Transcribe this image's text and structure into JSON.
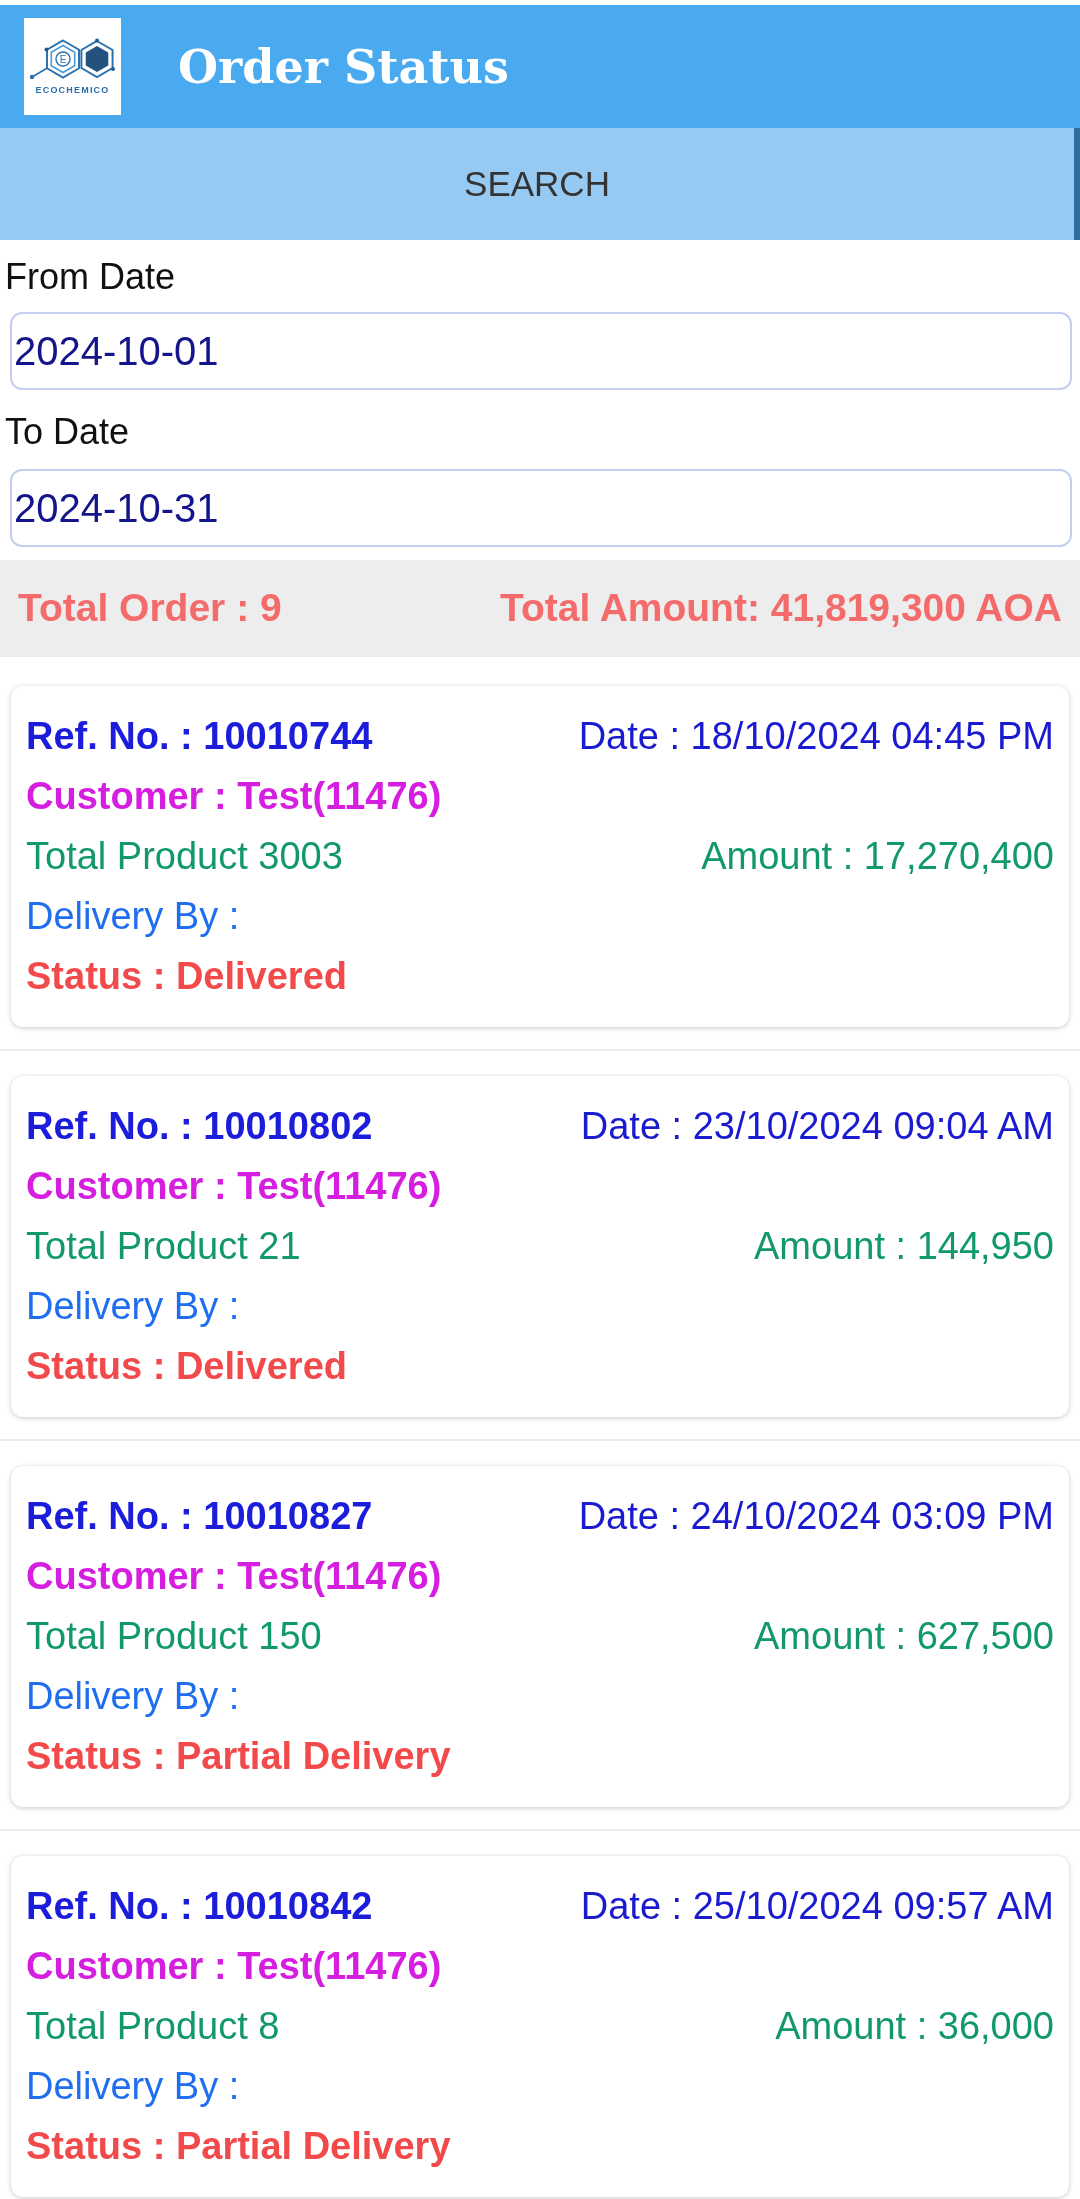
{
  "app_bar": {
    "logo": {
      "letter": "E",
      "wordmark": "ECOCHEMICO"
    },
    "title": "Order Status"
  },
  "search_button": {
    "label": "SEARCH"
  },
  "filters": [
    {
      "label": "From Date",
      "value": "2024-10-01"
    },
    {
      "label": "To Date",
      "value": "2024-10-31"
    }
  ],
  "summary": {
    "total_order": "Total Order : 9",
    "total_amount": "Total Amount: 41,819,300 AOA"
  },
  "orders": [
    {
      "ref": "Ref. No. : 10010744",
      "date": "Date : 18/10/2024 04:45 PM",
      "customer": "Customer : Test(11476)",
      "total_product": "Total Product 3003",
      "amount": "Amount : 17,270,400",
      "delivery_by": "Delivery By :",
      "status": "Status : Delivered"
    },
    {
      "ref": "Ref. No. : 10010802",
      "date": "Date : 23/10/2024 09:04 AM",
      "customer": "Customer : Test(11476)",
      "total_product": "Total Product 21",
      "amount": "Amount : 144,950",
      "delivery_by": "Delivery By :",
      "status": "Status : Delivered"
    },
    {
      "ref": "Ref. No. : 10010827",
      "date": "Date : 24/10/2024 03:09 PM",
      "customer": "Customer : Test(11476)",
      "total_product": "Total Product 150",
      "amount": "Amount : 627,500",
      "delivery_by": "Delivery By :",
      "status": "Status : Partial Delivery"
    },
    {
      "ref": "Ref. No. : 10010842",
      "date": "Date : 25/10/2024 09:57 AM",
      "customer": "Customer : Test(11476)",
      "total_product": "Total Product 8",
      "amount": "Amount : 36,000",
      "delivery_by": "Delivery By :",
      "status": "Status : Partial Delivery"
    }
  ]
}
